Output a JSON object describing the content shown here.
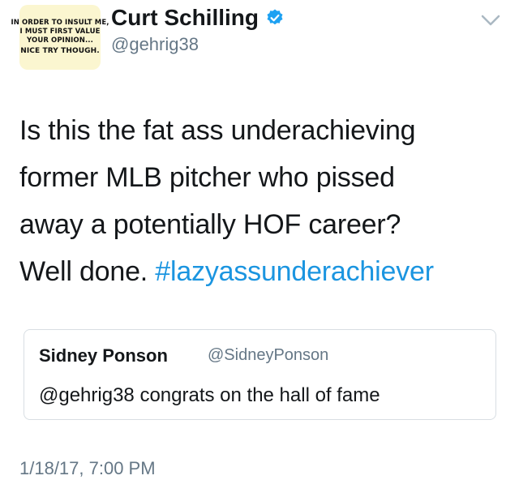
{
  "author": {
    "display_name": "Curt Schilling",
    "handle": "@gehrig38",
    "avatar_lines": [
      "IN ORDER TO INSULT ME,",
      "I MUST FIRST VALUE",
      "YOUR OPINION...",
      "NICE TRY THOUGH."
    ]
  },
  "tweet": {
    "lines": [
      "Is this the fat ass underachieving",
      "former MLB pitcher who pissed",
      "away a potentially HOF career?",
      "Well done. "
    ],
    "hashtag": "#lazyassunderachiever"
  },
  "quoted_tweet": {
    "display_name": "Sidney Ponson",
    "handle": "@SidneyPonson",
    "text": "@gehrig38 congrats on the hall of fame"
  },
  "timestamp": "1/18/17, 7:00 PM",
  "icons": {
    "verified": "verified-badge-icon",
    "menu": "chevron-down-icon"
  },
  "colors": {
    "link": "#1b95e0",
    "secondary_text": "#657786",
    "verified": "#1da1f2"
  }
}
